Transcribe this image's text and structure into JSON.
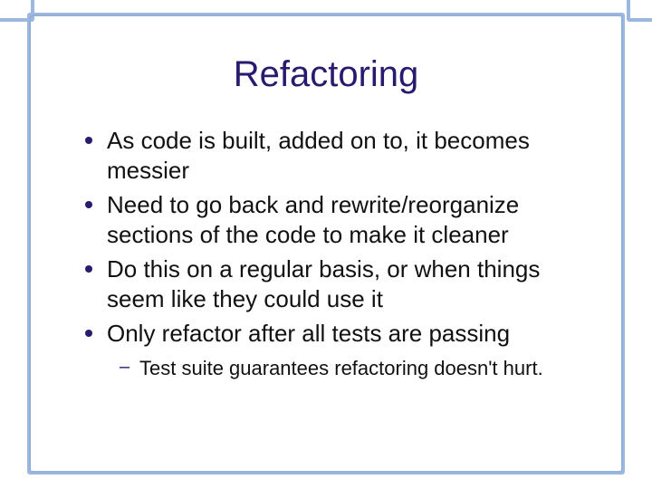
{
  "slide": {
    "title": "Refactoring",
    "bullets": [
      "As code is built, added on to, it becomes messier",
      "Need to go back and rewrite/reorganize sections of the code to make it cleaner",
      "Do this on a regular basis, or when things seem like they could use it",
      "Only refactor after all tests are passing"
    ],
    "sub_bullets": [
      "Test suite guarantees refactoring doesn't hurt."
    ]
  }
}
